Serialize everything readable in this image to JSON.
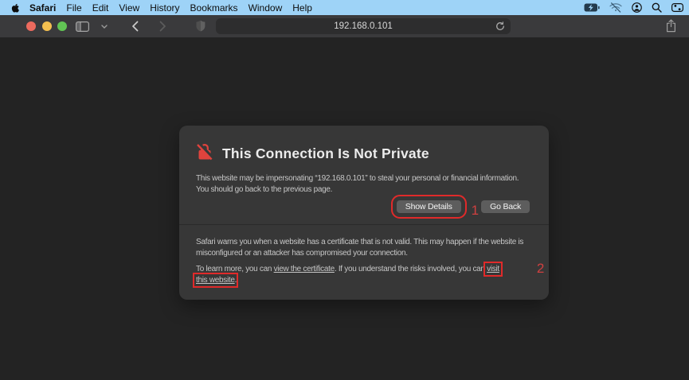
{
  "menu_bar": {
    "items": [
      "Safari",
      "File",
      "Edit",
      "View",
      "History",
      "Bookmarks",
      "Window",
      "Help"
    ],
    "status_icons": [
      "battery-charging-icon",
      "wifi-off-icon",
      "user-icon",
      "search-icon",
      "control-center-icon"
    ]
  },
  "toolbar": {
    "url": "192.168.0.101"
  },
  "dialog": {
    "title": "This Connection Is Not Private",
    "warning_text": "This website may be impersonating “192.168.0.101” to steal your personal or financial information. You should go back to the previous page.",
    "show_details_label": "Show Details",
    "go_back_label": "Go Back",
    "info_text": "Safari warns you when a website has a certificate that is not valid. This may happen if the website is misconfigured or an attacker has compromised your connection.",
    "learn_more": {
      "part1": "To learn more, you can ",
      "certificate_link": "view the certificate",
      "part2": ". If you understand the risks involved, you can ",
      "visit_link": "visit",
      "website_link": "this website",
      "part3": "."
    }
  },
  "annotations": {
    "step1": "1",
    "step2": "2"
  },
  "colors": {
    "menu_bar_blue": "#9ed3f7",
    "toolbar_gray": "#3a3a3c",
    "page_background": "#232323",
    "dialog_background": "#373737",
    "annotation_red": "#e02a2a",
    "warning_icon_red": "#e0433d",
    "traffic_red": "#ec6a5e",
    "traffic_yellow": "#f4bf4f",
    "traffic_green": "#61c454"
  }
}
